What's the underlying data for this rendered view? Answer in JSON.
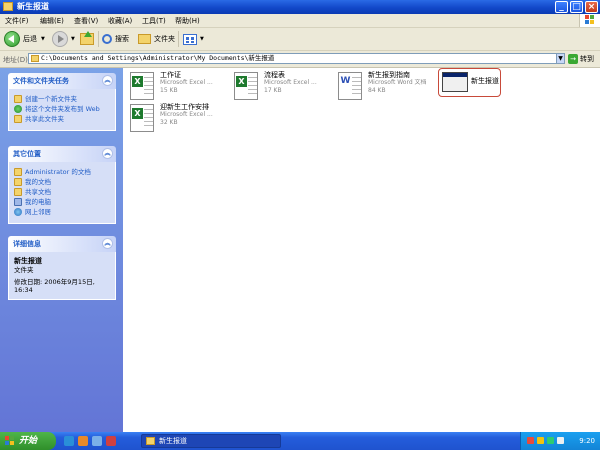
{
  "window": {
    "title": "新生报道"
  },
  "menu": [
    "文件(F)",
    "编辑(E)",
    "查看(V)",
    "收藏(A)",
    "工具(T)",
    "帮助(H)"
  ],
  "toolbar": {
    "back": "后退",
    "search": "搜索",
    "folders": "文件夹"
  },
  "address": {
    "label": "地址(D)",
    "path": "C:\\Documents and Settings\\Administrator\\My Documents\\新生报道",
    "go": "转到"
  },
  "tasks_panel": {
    "title": "文件和文件夹任务",
    "links": [
      "创建一个新文件夹",
      "将这个文件夹发布到 Web",
      "共享此文件夹"
    ]
  },
  "places_panel": {
    "title": "其它位置",
    "links": [
      "Administrator 的文档",
      "我的文档",
      "共享文档",
      "我的电脑",
      "网上邻居"
    ]
  },
  "details_panel": {
    "title": "详细信息",
    "name": "新生报道",
    "type": "文件夹",
    "modified": "修改日期: 2006年9月15日, 16:34"
  },
  "files": [
    {
      "name": "工作证",
      "type": "Microsoft Excel ...",
      "size": "15 KB",
      "icon": "excel-file-icon"
    },
    {
      "name": "流程表",
      "type": "Microsoft Excel ...",
      "size": "17 KB",
      "icon": "excel-file-icon"
    },
    {
      "name": "新生报到指南",
      "type": "Microsoft Word 文档",
      "size": "84 KB",
      "icon": "word-file-icon"
    },
    {
      "name": "新生报道",
      "type": "",
      "size": "",
      "icon": "folder-thumbnail-icon"
    },
    {
      "name": "迎新生工作安排",
      "type": "Microsoft Excel ...",
      "size": "32 KB",
      "icon": "excel-file-icon"
    }
  ],
  "taskbar": {
    "start": "开始",
    "task": "新生报道",
    "time": "9:20"
  },
  "colors": {
    "titlebar": "#1248c9",
    "taskbar": "#245ddb",
    "start": "#3a9a34",
    "panel_bg": "#d6dff7",
    "link": "#215dc6"
  }
}
